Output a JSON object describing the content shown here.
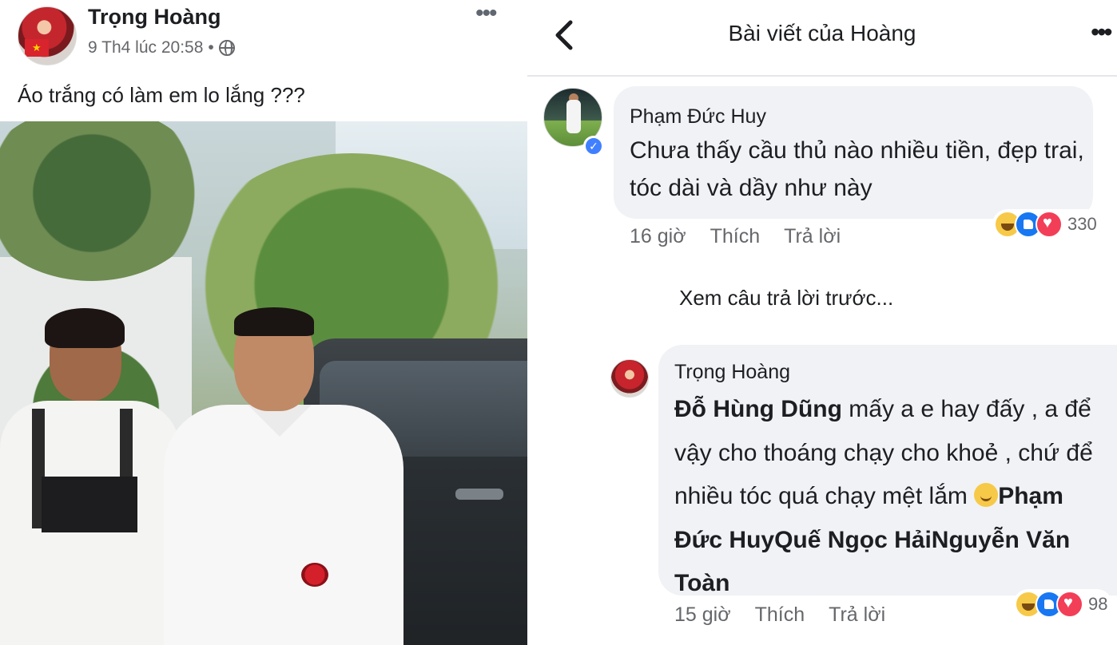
{
  "post": {
    "author": "Trọng Hoàng",
    "timestamp": "9 Th4 lúc 20:58",
    "separator": "•",
    "privacy_icon": "globe-icon",
    "more_label": "•••",
    "text": "Áo trắng có làm em lo lắng ???"
  },
  "comments_view": {
    "back_icon": "chevron-left-icon",
    "title": "Bài viết của Hoàng",
    "more_label": "•••",
    "comment_1": {
      "author": "Phạm Đức Huy",
      "verified_icon": "verified-badge-icon",
      "text": "Chưa thấy cầu thủ nào nhiều tiền, đẹp trai, tóc dài và dầy như này",
      "time": "16 giờ",
      "like_label": "Thích",
      "reply_label": "Trả lời",
      "reaction_count": "330"
    },
    "previous_replies": "Xem câu trả lời trước...",
    "comment_2": {
      "author": "Trọng Hoàng",
      "tag_1": "Đỗ Hùng Dũng",
      "text_1": " mấy a e hay đấy , a để vậy cho thoáng chạy cho khoẻ , chứ để nhiều tóc quá chạy mệt lắm ",
      "emoji_icon": "smile-emoji-icon",
      "tag_2": "Phạm Đức Huy",
      "tag_3": "Quế Ngọc Hải",
      "tag_4": "Nguyễn Văn Toàn",
      "time": "15 giờ",
      "like_label": "Thích",
      "reply_label": "Trả lời",
      "reaction_count": "98"
    }
  },
  "colors": {
    "bubble": "#f0f2f5",
    "meta_text": "#65676b",
    "like_blue": "#1877f2",
    "love_red": "#f33e58",
    "haha_yellow": "#f7c948"
  }
}
